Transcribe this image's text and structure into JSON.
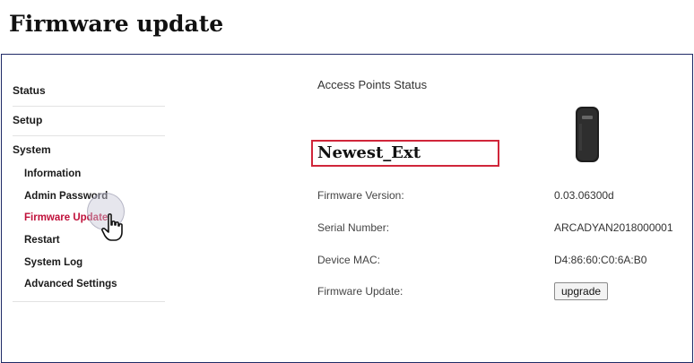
{
  "header": {
    "title": "Firmware update"
  },
  "sidebar": {
    "status": "Status",
    "setup": "Setup",
    "system": "System",
    "items": [
      {
        "label": "Information",
        "active": false
      },
      {
        "label": "Admin Password",
        "active": false
      },
      {
        "label": "Firmware Update",
        "active": true
      },
      {
        "label": "Restart",
        "active": false
      },
      {
        "label": "System Log",
        "active": false
      },
      {
        "label": "Advanced Settings",
        "active": false
      }
    ]
  },
  "main": {
    "section_title": "Access Points Status",
    "device_name": "Newest_Ext",
    "fields": {
      "firmware_version": {
        "label": "Firmware Version:",
        "value": "0.03.06300d"
      },
      "serial_number": {
        "label": "Serial Number:",
        "value": "ARCADYAN2018000001"
      },
      "device_mac": {
        "label": "Device MAC:",
        "value": "D4:86:60:C0:6A:B0"
      },
      "firmware_update": {
        "label": "Firmware Update:",
        "button": "upgrade"
      }
    }
  },
  "colors": {
    "active_link": "#c0103a",
    "highlight_box": "#d0263a",
    "frame_border": "#1f2a66"
  },
  "icons": {
    "cursor": "hand-pointer-icon",
    "device": "access-point-device-image"
  }
}
